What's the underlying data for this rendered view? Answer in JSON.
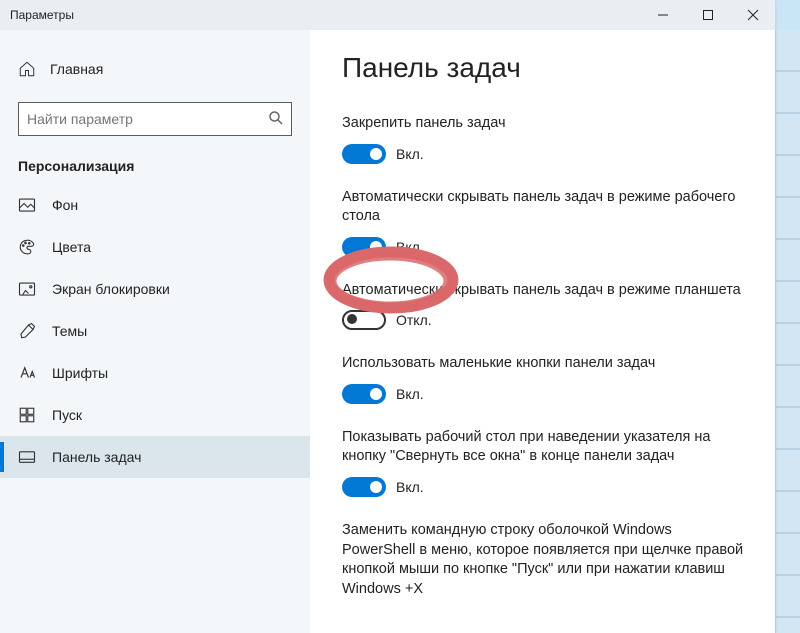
{
  "titlebar": {
    "title": "Параметры"
  },
  "sidebar": {
    "home": "Главная",
    "search_placeholder": "Найти параметр",
    "category": "Персонализация",
    "items": [
      {
        "label": "Фон"
      },
      {
        "label": "Цвета"
      },
      {
        "label": "Экран блокировки"
      },
      {
        "label": "Темы"
      },
      {
        "label": "Шрифты"
      },
      {
        "label": "Пуск"
      },
      {
        "label": "Панель задач"
      }
    ]
  },
  "content": {
    "heading": "Панель задач",
    "state_on": "Вкл.",
    "state_off": "Откл.",
    "options": [
      {
        "label": "Закрепить панель задач",
        "on": true
      },
      {
        "label": "Автоматически скрывать панель задач в режиме рабочего стола",
        "on": true
      },
      {
        "label": "Автоматически скрывать панель задач в режиме планшета",
        "on": false
      },
      {
        "label": "Использовать маленькие кнопки панели задач",
        "on": true
      },
      {
        "label": "Показывать рабочий стол при наведении указателя на кнопку \"Свернуть все окна\" в конце панели задач",
        "on": true
      },
      {
        "label": "Заменить командную строку оболочкой Windows PowerShell в меню, которое появляется при щелчке правой кнопкой мыши по кнопке \"Пуск\" или при нажатии клавиш Windows +X"
      }
    ]
  }
}
